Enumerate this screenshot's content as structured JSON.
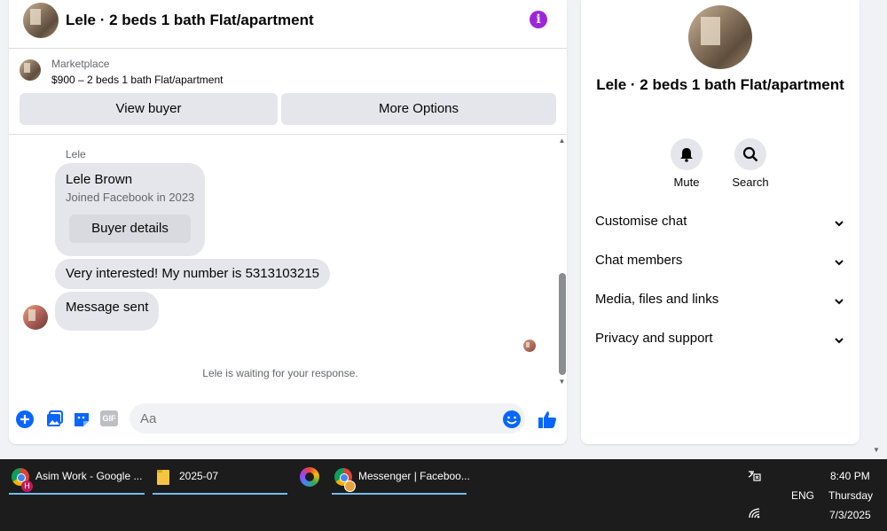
{
  "chat": {
    "header_title": "Lele · 2 beds 1 bath Flat/apartment",
    "marketplace_label": "Marketplace",
    "listing": "$900 – 2 beds 1 bath Flat/apartment",
    "view_buyer": "View buyer",
    "more_options": "More Options",
    "sender_name": "Lele",
    "card_name": "Lele Brown",
    "card_joined": "Joined Facebook in 2023",
    "card_button": "Buyer details",
    "message1": "Very interested! My number is 5313103215",
    "message2": "Message sent",
    "status": "Lele is waiting for your response.",
    "input_placeholder": "Aa",
    "gif_label": "GIF"
  },
  "details": {
    "title": "Lele · 2 beds 1 bath Flat/apartment",
    "mute_label": "Mute",
    "search_label": "Search",
    "sections": [
      "Customise chat",
      "Chat members",
      "Media, files and links",
      "Privacy and support"
    ]
  },
  "taskbar": {
    "items": [
      {
        "label": "Asim Work - Google ...",
        "icon": "chrome-icon"
      },
      {
        "label": "2025-07",
        "icon": "folder-icon"
      },
      {
        "label": "",
        "icon": "app-icon"
      },
      {
        "label": "Messenger | Faceboo...",
        "icon": "chrome-icon"
      }
    ],
    "time": "8:40 PM",
    "day": "Thursday",
    "date": "7/3/2025",
    "lang": "ENG"
  },
  "colors": {
    "accent": "#0866ff",
    "info": "#9c27d9",
    "bubble": "#e4e6eb",
    "taskbar": "#1c1c1c"
  }
}
